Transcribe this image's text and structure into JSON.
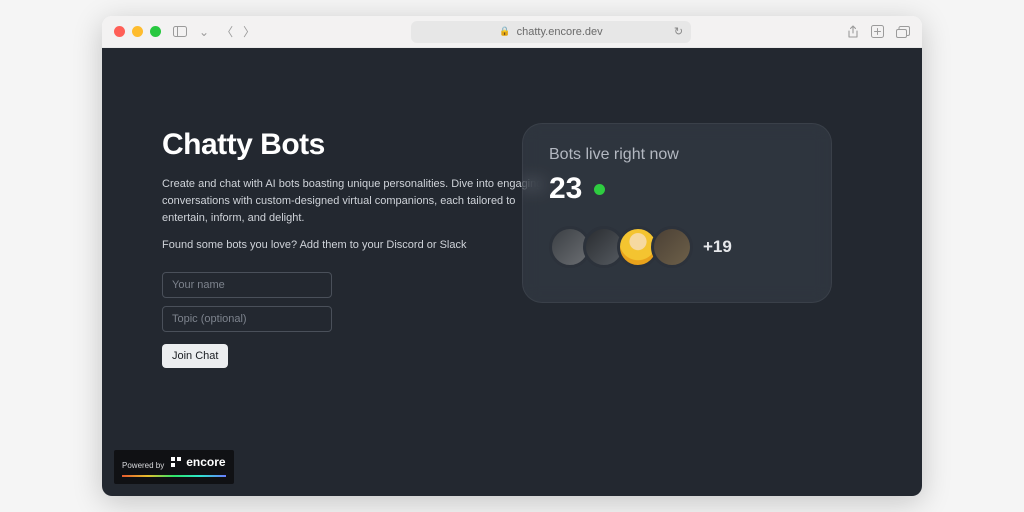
{
  "browser": {
    "url": "chatty.encore.dev"
  },
  "hero": {
    "title": "Chatty Bots",
    "paragraph1": "Create and chat with AI bots boasting unique personalities. Dive into engaging conversations with custom-designed virtual companions, each tailored to entertain, inform, and delight.",
    "paragraph2": "Found some bots you love? Add them to your Discord or Slack"
  },
  "form": {
    "name_placeholder": "Your name",
    "topic_placeholder": "Topic (optional)",
    "submit_label": "Join Chat"
  },
  "live_card": {
    "title": "Bots live right now",
    "count": "23",
    "overflow": "+19"
  },
  "badge": {
    "powered": "Powered by",
    "brand": "encore"
  }
}
